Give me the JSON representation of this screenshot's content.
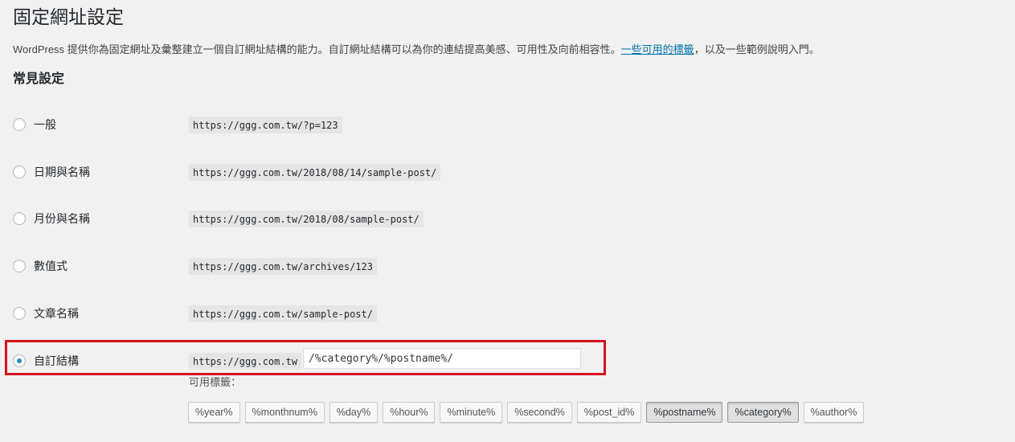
{
  "page": {
    "title": "固定網址設定",
    "intro_text": "WordPress 提供你為固定網址及彙整建立一個自訂網址結構的能力。自訂網址結構可以為你的連結提高美感、可用性及向前相容性。",
    "intro_link": "一些可用的標籤",
    "intro_suffix": "，以及一些範例說明入門。"
  },
  "common_settings": {
    "title": "常見設定",
    "options": [
      {
        "label": "一般",
        "example": "https://ggg.com.tw/?p=123",
        "checked": false
      },
      {
        "label": "日期與名稱",
        "example": "https://ggg.com.tw/2018/08/14/sample-post/",
        "checked": false
      },
      {
        "label": "月份與名稱",
        "example": "https://ggg.com.tw/2018/08/sample-post/",
        "checked": false
      },
      {
        "label": "數值式",
        "example": "https://ggg.com.tw/archives/123",
        "checked": false
      },
      {
        "label": "文章名稱",
        "example": "https://ggg.com.tw/sample-post/",
        "checked": false
      }
    ],
    "custom": {
      "label": "自訂結構",
      "base": "https://ggg.com.tw",
      "value": "/%category%/%postname%/",
      "checked": true
    }
  },
  "available_tags": {
    "label": "可用標籤：",
    "tags": [
      {
        "text": "%year%",
        "active": false
      },
      {
        "text": "%monthnum%",
        "active": false
      },
      {
        "text": "%day%",
        "active": false
      },
      {
        "text": "%hour%",
        "active": false
      },
      {
        "text": "%minute%",
        "active": false
      },
      {
        "text": "%second%",
        "active": false
      },
      {
        "text": "%post_id%",
        "active": false
      },
      {
        "text": "%postname%",
        "active": true
      },
      {
        "text": "%category%",
        "active": true
      },
      {
        "text": "%author%",
        "active": false
      }
    ]
  },
  "colors": {
    "highlight_border": "#d4121e",
    "link": "#0073aa",
    "radio_checked": "#1e8cbe"
  }
}
